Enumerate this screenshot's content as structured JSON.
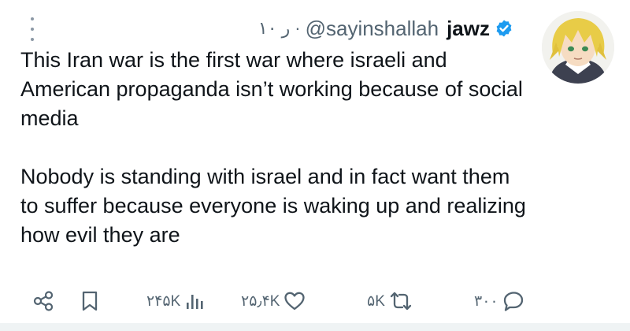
{
  "post": {
    "time": "۱۰ ر",
    "handle": "@sayinshallah",
    "display_name": "jawz",
    "verified": true,
    "paragraphs": [
      "This Iran war is the first war where israeli and American propaganda isn’t working because of social media",
      "Nobody is standing with israel and in fact want them to suffer because everyone is waking up and realizing how evil they are"
    ]
  },
  "actions": {
    "views": "۲۴۵K",
    "likes": "۲۵٫۴K",
    "reposts": "۵K",
    "replies": "۳۰۰"
  },
  "colors": {
    "text": "#0f1419",
    "secondary": "#536471",
    "verified": "#1d9bf0",
    "divider": "#eff3f4"
  },
  "icons": [
    "more-vertical-icon",
    "verified-badge-icon",
    "share-icon",
    "bookmark-icon",
    "views-icon",
    "like-icon",
    "repost-icon",
    "reply-icon"
  ]
}
